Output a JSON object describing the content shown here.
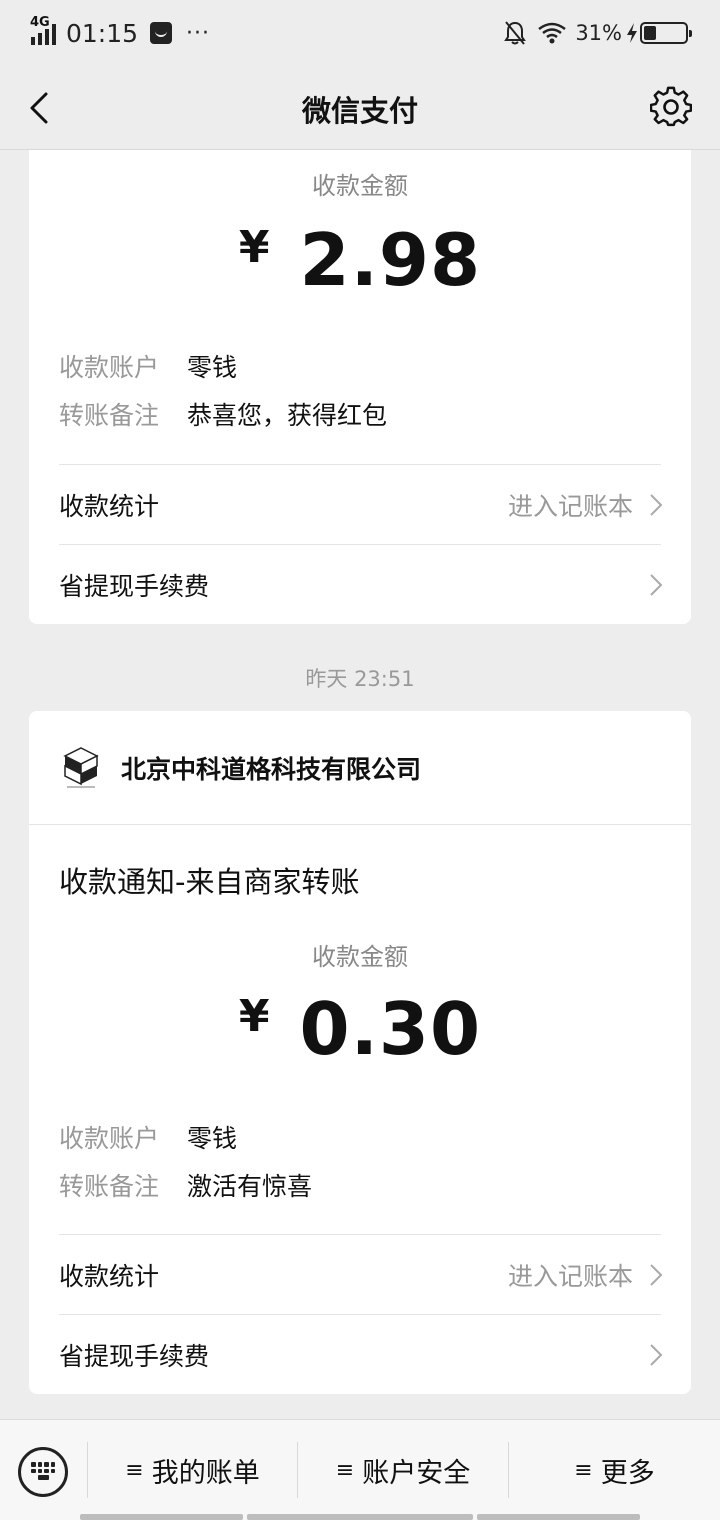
{
  "status_bar": {
    "network": "4G",
    "time": "01:15",
    "more": "···",
    "battery_text": "31%",
    "battery_level": 0.31
  },
  "nav": {
    "title": "微信支付"
  },
  "messages": [
    {
      "amount_label": "收款金额",
      "currency": "¥",
      "amount": "2.98",
      "account_key": "收款账户",
      "account_value": "零钱",
      "remark_key": "转账备注",
      "remark_value": "恭喜您，获得红包",
      "stats_label": "收款统计",
      "stats_hint": "进入记账本",
      "fee_label": "省提现手续费"
    },
    {
      "timestamp": "昨天 23:51",
      "merchant": "北京中科道格科技有限公司",
      "title": "收款通知-来自商家转账",
      "amount_label": "收款金额",
      "currency": "¥",
      "amount": "0.30",
      "account_key": "收款账户",
      "account_value": "零钱",
      "remark_key": "转账备注",
      "remark_value": "激活有惊喜",
      "stats_label": "收款统计",
      "stats_hint": "进入记账本",
      "fee_label": "省提现手续费"
    }
  ],
  "bottom_bar": {
    "menu_glyph": "≡",
    "tabs": [
      "我的账单",
      "账户安全",
      "更多"
    ]
  }
}
